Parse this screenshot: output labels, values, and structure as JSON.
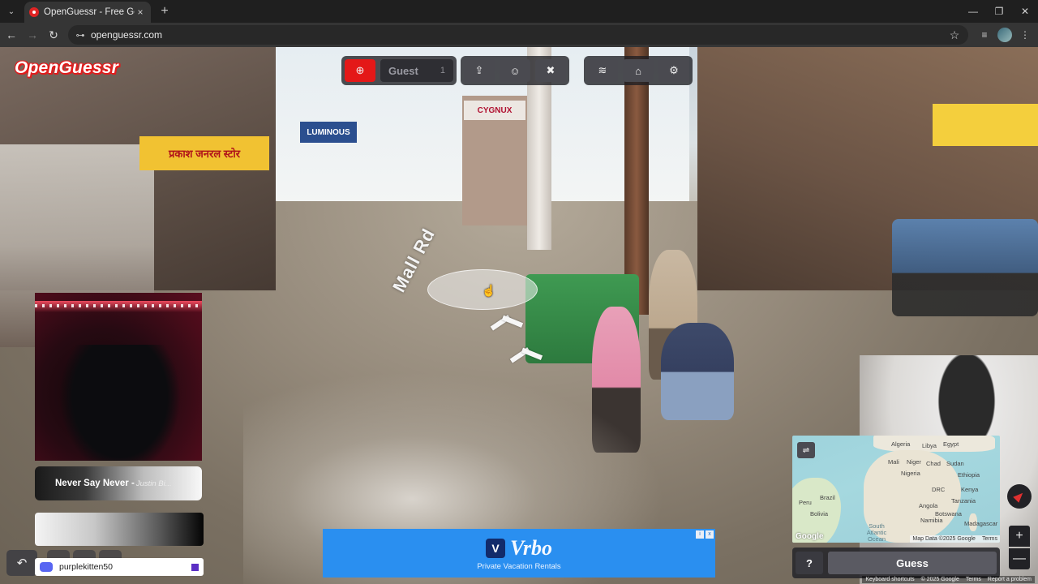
{
  "browser": {
    "tab_title": "OpenGuessr - Free GeoGuessr A",
    "tab_close": "×",
    "new_tab": "+",
    "url": "openguessr.com",
    "back": "←",
    "forward": "→",
    "reload": "↻",
    "bookmark": "☆",
    "minimize": "—",
    "restore": "❐",
    "close": "✕",
    "tab_dropdown": "⌄"
  },
  "logo": "OpenGuessr",
  "toolbar": {
    "profile_icon": "⊕",
    "guest_name": "Guest",
    "guest_count": "1",
    "buttons": [
      {
        "icon": "⇪"
      },
      {
        "icon": "☺"
      },
      {
        "icon": "✖"
      },
      {
        "icon": "≋"
      },
      {
        "icon": "⌂"
      },
      {
        "icon": "⚙"
      }
    ]
  },
  "street": {
    "label": "Mall Rd",
    "signs": {
      "yellow": "प्रकाश जनरल स्टोर",
      "luminous": "LUMINOUS",
      "cygnux": "CYGNUX"
    }
  },
  "song": {
    "title": "Never Say Never -",
    "artist": "Justin Bi..."
  },
  "undo_icon": "↶",
  "discord": {
    "username": "purplekitten50"
  },
  "ad": {
    "logo_letter": "V",
    "brand": "Vrbo",
    "tagline": "Private Vacation Rentals",
    "badge_i": "i",
    "badge_x": "x"
  },
  "minimap": {
    "settings_icon": "⇌",
    "labels": [
      {
        "text": "Algeria"
      },
      {
        "text": "Libya"
      },
      {
        "text": "Egypt"
      },
      {
        "text": "Mali"
      },
      {
        "text": "Niger"
      },
      {
        "text": "Chad"
      },
      {
        "text": "Sudan"
      },
      {
        "text": "Nigeria"
      },
      {
        "text": "Ethiopia"
      },
      {
        "text": "DRC"
      },
      {
        "text": "Kenya"
      },
      {
        "text": "Tanzania"
      },
      {
        "text": "Angola"
      },
      {
        "text": "Namibia"
      },
      {
        "text": "Botswana"
      },
      {
        "text": "Madagascar"
      },
      {
        "text": "Peru"
      },
      {
        "text": "Brazil"
      },
      {
        "text": "Bolivia"
      },
      {
        "text": "South Atlantic Ocean"
      }
    ],
    "google": "Google",
    "attribution": "Map Data ©2025 Google",
    "terms": "Terms"
  },
  "guess": {
    "help": "?",
    "label": "Guess"
  },
  "zoom": {
    "in": "+",
    "out": "—"
  },
  "footer": {
    "shortcuts": "Keyboard shortcuts",
    "copyright": "© 2025 Google",
    "terms": "Terms",
    "report": "Report a problem"
  }
}
